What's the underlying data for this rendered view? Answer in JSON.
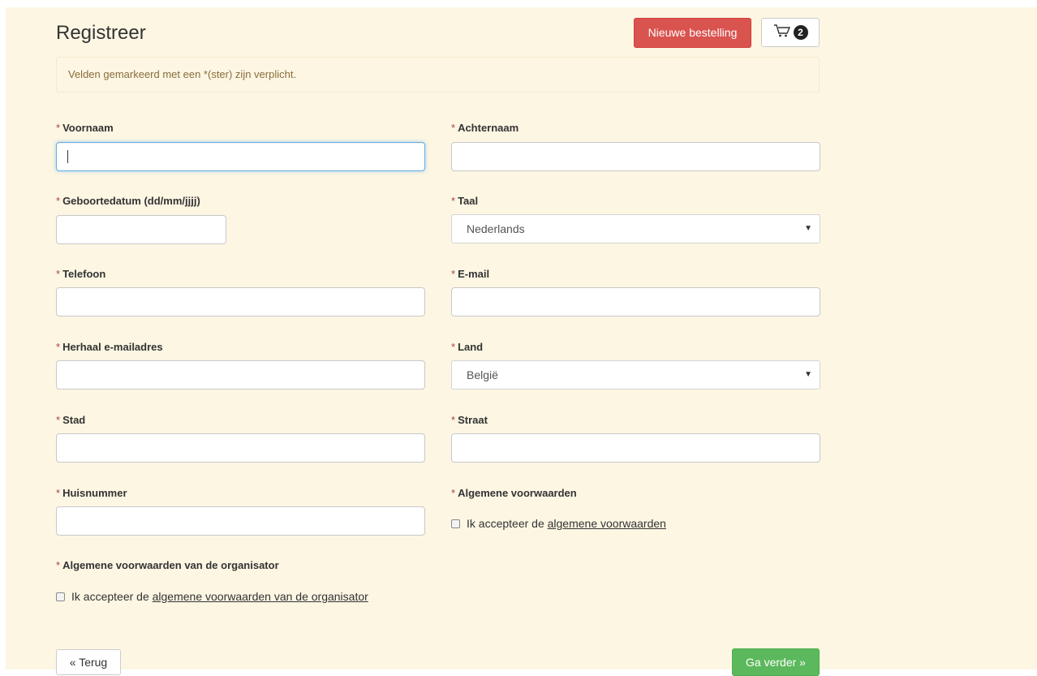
{
  "header": {
    "title": "Registreer",
    "new_order_label": "Nieuwe bestelling",
    "cart_count": "2"
  },
  "notice": "Velden gemarkeerd met een *(ster) zijn verplicht.",
  "required_mark": "*",
  "fields": {
    "voornaam": {
      "label": "Voornaam",
      "value": ""
    },
    "achternaam": {
      "label": "Achternaam",
      "value": ""
    },
    "geboortedatum": {
      "label": "Geboortedatum (dd/mm/jjjj)",
      "value": ""
    },
    "taal": {
      "label": "Taal",
      "selected": "Nederlands"
    },
    "telefoon": {
      "label": "Telefoon",
      "value": ""
    },
    "email": {
      "label": "E-mail",
      "value": ""
    },
    "herhaal_email": {
      "label": "Herhaal e-mailadres",
      "value": ""
    },
    "land": {
      "label": "Land",
      "selected": "België"
    },
    "stad": {
      "label": "Stad",
      "value": ""
    },
    "straat": {
      "label": "Straat",
      "value": ""
    },
    "huisnummer": {
      "label": "Huisnummer",
      "value": ""
    }
  },
  "terms": {
    "label": "Algemene voorwaarden",
    "prefix": "Ik accepteer de",
    "link": "algemene voorwaarden",
    "checked": false
  },
  "organizer_terms": {
    "label": "Algemene voorwaarden van de organisator",
    "prefix": "Ik accepteer de",
    "link": "algemene voorwaarden van de organisator",
    "checked": false
  },
  "footer": {
    "back_label": "« Terug",
    "next_label": "Ga verder »"
  },
  "colors": {
    "panel_bg": "#fcf6e3",
    "danger": "#d9534f",
    "success": "#5cb85c",
    "required": "#a94442"
  },
  "icons": {
    "cart": "shopping-cart-icon",
    "select_arrow": "chevron-down-icon"
  }
}
